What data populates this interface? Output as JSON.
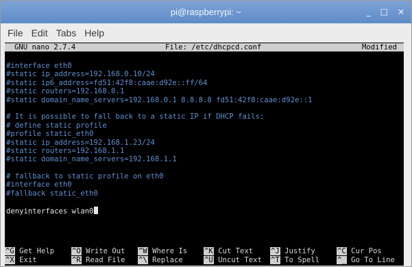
{
  "window": {
    "title": "pi@raspberrypi: ~",
    "minimize": "_",
    "maximize": "□",
    "close": "×"
  },
  "menu": [
    "File",
    "Edit",
    "Tabs",
    "Help"
  ],
  "nano": {
    "version": "GNU nano 2.7.4",
    "file": "File: /etc/dhcpcd.conf",
    "status": "Modified"
  },
  "lines": [
    {
      "text": "#interface eth0",
      "type": "comment"
    },
    {
      "text": "#static ip_address=192.168.0.10/24",
      "type": "comment"
    },
    {
      "text": "#static ip6_address=fd51:42f8:caae:d92e::ff/64",
      "type": "comment"
    },
    {
      "text": "#static routers=192.168.0.1",
      "type": "comment"
    },
    {
      "text": "#static domain_name_servers=192.168.0.1 8.8.8.8 fd51:42f8:caae:d92e::1",
      "type": "comment"
    },
    {
      "text": "",
      "type": "blank"
    },
    {
      "text": "# It is possible to fall back to a static IP if DHCP fails:",
      "type": "comment"
    },
    {
      "text": "# define static profile",
      "type": "comment"
    },
    {
      "text": "#profile static_eth0",
      "type": "comment"
    },
    {
      "text": "#static ip_address=192.168.1.23/24",
      "type": "comment"
    },
    {
      "text": "#static routers=192.168.1.1",
      "type": "comment"
    },
    {
      "text": "#static domain_name_servers=192.168.1.1",
      "type": "comment"
    },
    {
      "text": "",
      "type": "blank"
    },
    {
      "text": "# fallback to static profile on eth0",
      "type": "comment"
    },
    {
      "text": "#interface eth0",
      "type": "comment"
    },
    {
      "text": "#fallback static_eth0",
      "type": "comment"
    },
    {
      "text": "",
      "type": "blank"
    },
    {
      "text": "denyinterfaces wlan0",
      "type": "plain",
      "cursor": true
    }
  ],
  "shortcuts": [
    [
      {
        "key": "^G",
        "label": "Get Help"
      },
      {
        "key": "^O",
        "label": "Write Out"
      },
      {
        "key": "^W",
        "label": "Where Is"
      },
      {
        "key": "^K",
        "label": "Cut Text"
      },
      {
        "key": "^J",
        "label": "Justify"
      },
      {
        "key": "^C",
        "label": "Cur Pos"
      }
    ],
    [
      {
        "key": "^X",
        "label": "Exit"
      },
      {
        "key": "^R",
        "label": "Read File"
      },
      {
        "key": "^\\",
        "label": "Replace"
      },
      {
        "key": "^U",
        "label": "Uncut Text"
      },
      {
        "key": "^T",
        "label": "To Spell"
      },
      {
        "key": "^_",
        "label": "Go To Line"
      }
    ]
  ],
  "colors": {
    "titlebar": "#6b96cf",
    "comment": "#5f8fd1",
    "terminal_bg": "#000000",
    "header_bg": "#cfcfcf"
  }
}
